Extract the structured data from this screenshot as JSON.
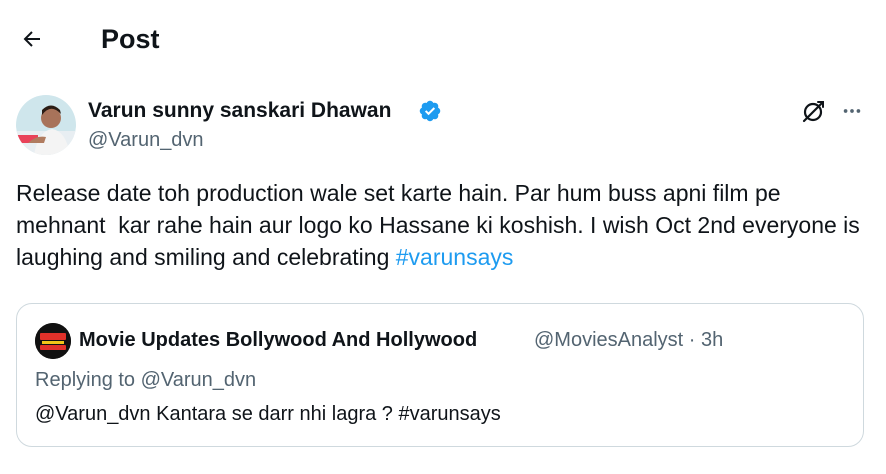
{
  "header": {
    "back_icon": "arrow-left-icon",
    "title": "Post"
  },
  "author": {
    "name": "Varun sunny sanskari Dhawan",
    "handle": "@Varun_dvn",
    "verified": true,
    "verified_color": "#1d9bf0"
  },
  "actions": {
    "grok_icon": "grok-icon",
    "more_icon": "more-horizontal-icon"
  },
  "post": {
    "text": "Release date toh production wale set karte hain. Par hum buss apni film pe mehnant  kar rahe hain aur logo ko Hassane ki koshish. I wish Oct 2nd everyone is laughing and smiling and celebrating ",
    "hashtag": "#varunsays",
    "hashtag_color": "#1d9bf0"
  },
  "quote": {
    "name": "Movie Updates Bollywood And Hollywood",
    "meta": "@MoviesAnalyst · 3h",
    "replying_to": "Replying to @Varun_dvn",
    "text": "@Varun_dvn Kantara se darr nhi lagra ? #varunsays"
  },
  "colors": {
    "text_primary": "#0f1419",
    "text_secondary": "#536471",
    "border": "#cfd9de"
  }
}
